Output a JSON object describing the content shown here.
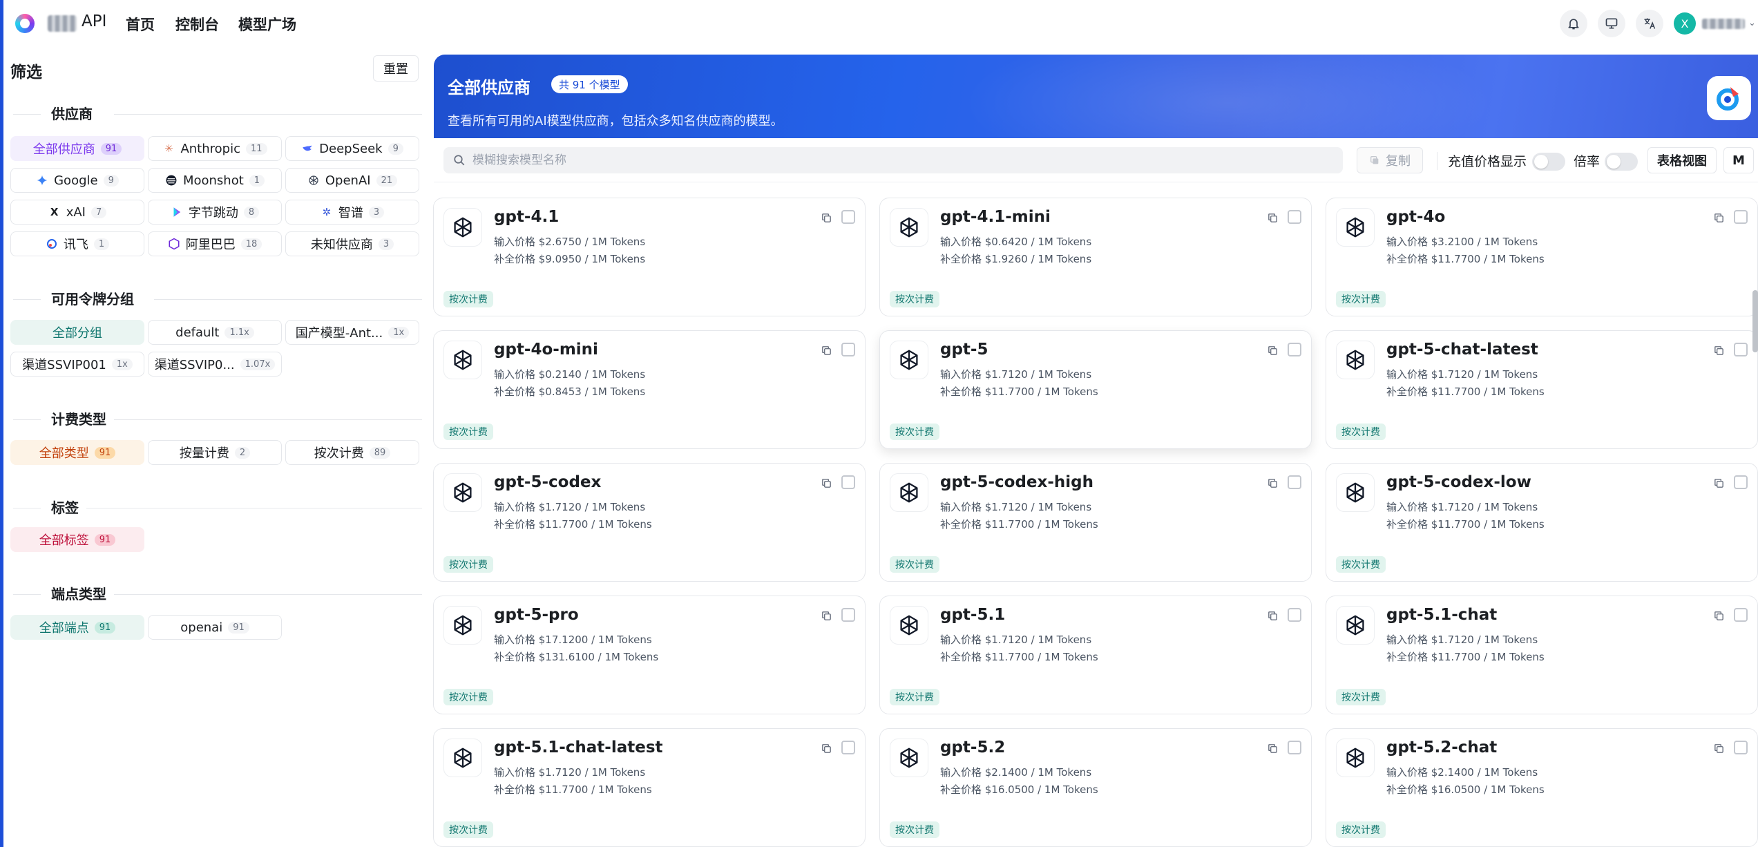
{
  "header": {
    "brand_suffix": "API",
    "nav": [
      "首页",
      "控制台",
      "模型广场"
    ],
    "avatar_letter": "X"
  },
  "sidebar": {
    "title": "筛选",
    "reset_label": "重置",
    "sections": {
      "providers": {
        "title": "供应商",
        "items": [
          {
            "label": "全部供应商",
            "count": "91",
            "icon": "all"
          },
          {
            "label": "Anthropic",
            "count": "11",
            "icon": "anthropic-icon"
          },
          {
            "label": "DeepSeek",
            "count": "9",
            "icon": "deepseek-icon"
          },
          {
            "label": "Google",
            "count": "9",
            "icon": "gemini-icon"
          },
          {
            "label": "Moonshot",
            "count": "1",
            "icon": "moonshot-icon"
          },
          {
            "label": "OpenAI",
            "count": "21",
            "icon": "openai-icon"
          },
          {
            "label": "xAI",
            "count": "7",
            "icon": "xai-icon"
          },
          {
            "label": "字节跳动",
            "count": "8",
            "icon": "bytedance-icon"
          },
          {
            "label": "智谱",
            "count": "3",
            "icon": "zhipu-icon"
          },
          {
            "label": "讯飞",
            "count": "1",
            "icon": "xunfei-icon"
          },
          {
            "label": "阿里巴巴",
            "count": "18",
            "icon": "alibaba-icon"
          },
          {
            "label": "未知供应商",
            "count": "3",
            "icon": "none"
          }
        ]
      },
      "groups": {
        "title": "可用令牌分组",
        "items": [
          {
            "label": "全部分组",
            "count": ""
          },
          {
            "label": "default",
            "count": "1.1x"
          },
          {
            "label": "国产模型-Ant...",
            "count": "1x"
          },
          {
            "label": "渠道SSVIP001",
            "count": "1x"
          },
          {
            "label": "渠道SSVIP0...",
            "count": "1.07x"
          }
        ]
      },
      "billing": {
        "title": "计费类型",
        "items": [
          {
            "label": "全部类型",
            "count": "91"
          },
          {
            "label": "按量计费",
            "count": "2"
          },
          {
            "label": "按次计费",
            "count": "89"
          }
        ]
      },
      "tags": {
        "title": "标签",
        "items": [
          {
            "label": "全部标签",
            "count": "91"
          }
        ]
      },
      "endpoints": {
        "title": "端点类型",
        "items": [
          {
            "label": "全部端点",
            "count": "91"
          },
          {
            "label": "openai",
            "count": "91"
          }
        ]
      }
    }
  },
  "hero": {
    "title": "全部供应商",
    "badge": "共 91 个模型",
    "subtitle": "查看所有可用的AI模型供应商，包括众多知名供应商的模型。"
  },
  "toolbar": {
    "search_placeholder": "模糊搜索模型名称",
    "copy_label": "复制",
    "recharge_label": "充值价格显示",
    "ratio_label": "倍率",
    "table_view_label": "表格视图",
    "m_label": "M"
  },
  "models": [
    {
      "name": "gpt-4.1",
      "input": "输入价格 $2.6750 / 1M Tokens",
      "completion": "补全价格 $9.0950 / 1M Tokens",
      "tag": "按次计费"
    },
    {
      "name": "gpt-4.1-mini",
      "input": "输入价格 $0.6420 / 1M Tokens",
      "completion": "补全价格 $1.9260 / 1M Tokens",
      "tag": "按次计费"
    },
    {
      "name": "gpt-4o",
      "input": "输入价格 $3.2100 / 1M Tokens",
      "completion": "补全价格 $11.7700 / 1M Tokens",
      "tag": "按次计费"
    },
    {
      "name": "gpt-4o-mini",
      "input": "输入价格 $0.2140 / 1M Tokens",
      "completion": "补全价格 $0.8453 / 1M Tokens",
      "tag": "按次计费"
    },
    {
      "name": "gpt-5",
      "input": "输入价格 $1.7120 / 1M Tokens",
      "completion": "补全价格 $11.7700 / 1M Tokens",
      "tag": "按次计费"
    },
    {
      "name": "gpt-5-chat-latest",
      "input": "输入价格 $1.7120 / 1M Tokens",
      "completion": "补全价格 $11.7700 / 1M Tokens",
      "tag": "按次计费"
    },
    {
      "name": "gpt-5-codex",
      "input": "输入价格 $1.7120 / 1M Tokens",
      "completion": "补全价格 $11.7700 / 1M Tokens",
      "tag": "按次计费"
    },
    {
      "name": "gpt-5-codex-high",
      "input": "输入价格 $1.7120 / 1M Tokens",
      "completion": "补全价格 $11.7700 / 1M Tokens",
      "tag": "按次计费"
    },
    {
      "name": "gpt-5-codex-low",
      "input": "输入价格 $1.7120 / 1M Tokens",
      "completion": "补全价格 $11.7700 / 1M Tokens",
      "tag": "按次计费"
    },
    {
      "name": "gpt-5-pro",
      "input": "输入价格 $17.1200 / 1M Tokens",
      "completion": "补全价格 $131.6100 / 1M Tokens",
      "tag": "按次计费"
    },
    {
      "name": "gpt-5.1",
      "input": "输入价格 $1.7120 / 1M Tokens",
      "completion": "补全价格 $11.7700 / 1M Tokens",
      "tag": "按次计费"
    },
    {
      "name": "gpt-5.1-chat",
      "input": "输入价格 $1.7120 / 1M Tokens",
      "completion": "补全价格 $11.7700 / 1M Tokens",
      "tag": "按次计费"
    },
    {
      "name": "gpt-5.1-chat-latest",
      "input": "输入价格 $1.7120 / 1M Tokens",
      "completion": "补全价格 $11.7700 / 1M Tokens",
      "tag": "按次计费"
    },
    {
      "name": "gpt-5.2",
      "input": "输入价格 $2.1400 / 1M Tokens",
      "completion": "补全价格 $16.0500 / 1M Tokens",
      "tag": "按次计费"
    },
    {
      "name": "gpt-5.2-chat",
      "input": "输入价格 $2.1400 / 1M Tokens",
      "completion": "补全价格 $16.0500 / 1M Tokens",
      "tag": "按次计费"
    }
  ],
  "colors": {
    "accent": "#2563eb",
    "active_provider": "#7c3aed",
    "active_group": "#0f766e",
    "active_billing": "#c2410c",
    "active_tag": "#be123c",
    "tag_bg": "#e1f4ee"
  }
}
